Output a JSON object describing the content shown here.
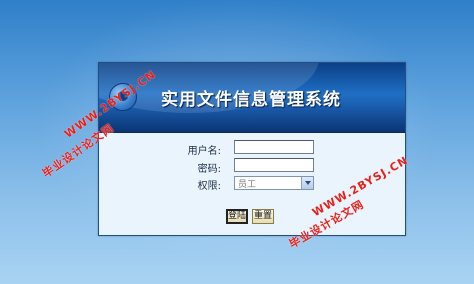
{
  "app": {
    "title": "实用文件信息管理系统"
  },
  "form": {
    "username_label": "用户名:",
    "username_value": "",
    "password_label": "密码:",
    "password_value": "",
    "role_label": "权限:",
    "role_selected": "员工"
  },
  "buttons": {
    "login_label": "登陆",
    "reset_label": "重置"
  },
  "watermarks": {
    "url_top": "WWW.2BYSJ.CN",
    "text_left": "毕业设计论文网",
    "url_right": "WWW.2BYSJ.CN",
    "text_right": "毕业设计论文网"
  },
  "colors": {
    "background_top": "#2f7fc9",
    "background_bottom": "#a9d3f3",
    "banner": "#1f6fc4",
    "panel": "#eaf4fc",
    "watermark": "#e8201c"
  },
  "icons": {
    "logo": "app-logo-icon",
    "dropdown": "chevron-down-icon"
  }
}
